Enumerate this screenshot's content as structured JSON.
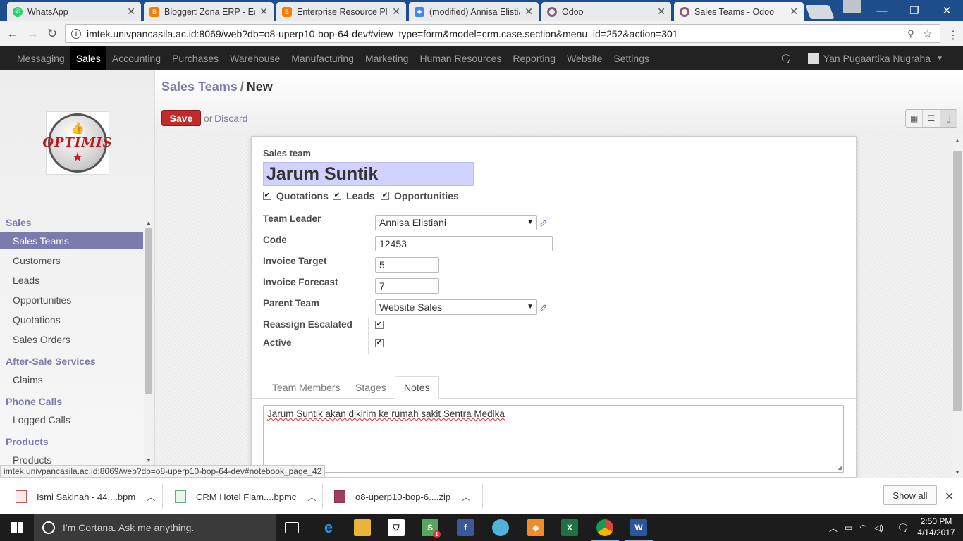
{
  "browser": {
    "tabs": [
      {
        "title": "WhatsApp",
        "icon": "whatsapp-icon",
        "color": "#25d366"
      },
      {
        "title": "Blogger: Zona ERP - Edi",
        "icon": "blogger-icon",
        "color": "#f57d00"
      },
      {
        "title": "Enterprise Resource Plan",
        "icon": "blogger-icon",
        "color": "#f57d00"
      },
      {
        "title": "(modified) Annisa Elistia",
        "icon": "drive-icon",
        "color": "#4285f4"
      },
      {
        "title": "Odoo",
        "icon": "odoo-icon",
        "color": "#875a7b"
      },
      {
        "title": "Sales Teams - Odoo",
        "icon": "odoo-icon",
        "color": "#875a7b"
      }
    ],
    "url": "imtek.univpancasila.ac.id:8069/web?db=o8-uperp10-bop-64-dev#view_type=form&model=crm.case.section&menu_id=252&action=301",
    "status_url": "imtek.univpancasila.ac.id:8069/web?db=o8-uperp10-bop-64-dev#notebook_page_42"
  },
  "topnav": {
    "items": [
      "Messaging",
      "Sales",
      "Accounting",
      "Purchases",
      "Warehouse",
      "Manufacturing",
      "Marketing",
      "Human Resources",
      "Reporting",
      "Website",
      "Settings"
    ],
    "active": "Sales",
    "user": "Yan Pugaartika Nugraha"
  },
  "sidebar": {
    "logo_text": "OPTIMIS",
    "sections": [
      {
        "title": "Sales",
        "items": [
          "Sales Teams",
          "Customers",
          "Leads",
          "Opportunities",
          "Quotations",
          "Sales Orders"
        ]
      },
      {
        "title": "After-Sale Services",
        "items": [
          "Claims"
        ]
      },
      {
        "title": "Phone Calls",
        "items": [
          "Logged Calls"
        ]
      },
      {
        "title": "Products",
        "items": [
          "Products"
        ]
      }
    ],
    "active_item": "Sales Teams"
  },
  "header": {
    "breadcrumb_parent": "Sales Teams",
    "breadcrumb_sep": "/",
    "breadcrumb_current": "New",
    "save_label": "Save",
    "or_label": "or",
    "discard_label": "Discard"
  },
  "form": {
    "name_label": "Sales team",
    "name_value": "Jarum Suntik",
    "checks": [
      {
        "label": "Quotations",
        "checked": true
      },
      {
        "label": "Leads",
        "checked": true
      },
      {
        "label": "Opportunities",
        "checked": true
      }
    ],
    "fields": {
      "team_leader": {
        "label": "Team Leader",
        "value": "Annisa Elistiani"
      },
      "code": {
        "label": "Code",
        "value": "12453"
      },
      "invoice_target": {
        "label": "Invoice Target",
        "value": "5"
      },
      "invoice_forecast": {
        "label": "Invoice Forecast",
        "value": "7"
      },
      "parent_team": {
        "label": "Parent Team",
        "value": "Website Sales"
      },
      "reassign_escalated": {
        "label": "Reassign Escalated",
        "checked": true
      },
      "active": {
        "label": "Active",
        "checked": true
      }
    },
    "tabs": [
      "Team Members",
      "Stages",
      "Notes"
    ],
    "active_tab": "Notes",
    "notes": "Jarum Suntik akan dikirim ke rumah sakit Sentra Medika"
  },
  "downloads": {
    "items": [
      "Ismi Sakinah - 44....bpm",
      "CRM Hotel Flam....bpmc",
      "o8-uperp10-bop-6....zip"
    ],
    "show_all_label": "Show all"
  },
  "taskbar": {
    "cortana_text": "I'm Cortana. Ask me anything.",
    "time": "2:50 PM",
    "date": "4/14/2017",
    "skype_badge": "1"
  },
  "colors": {
    "odoo_purple": "#7c7bad",
    "save_red": "#c02c2c",
    "title_bg": "#d2d2ff"
  }
}
